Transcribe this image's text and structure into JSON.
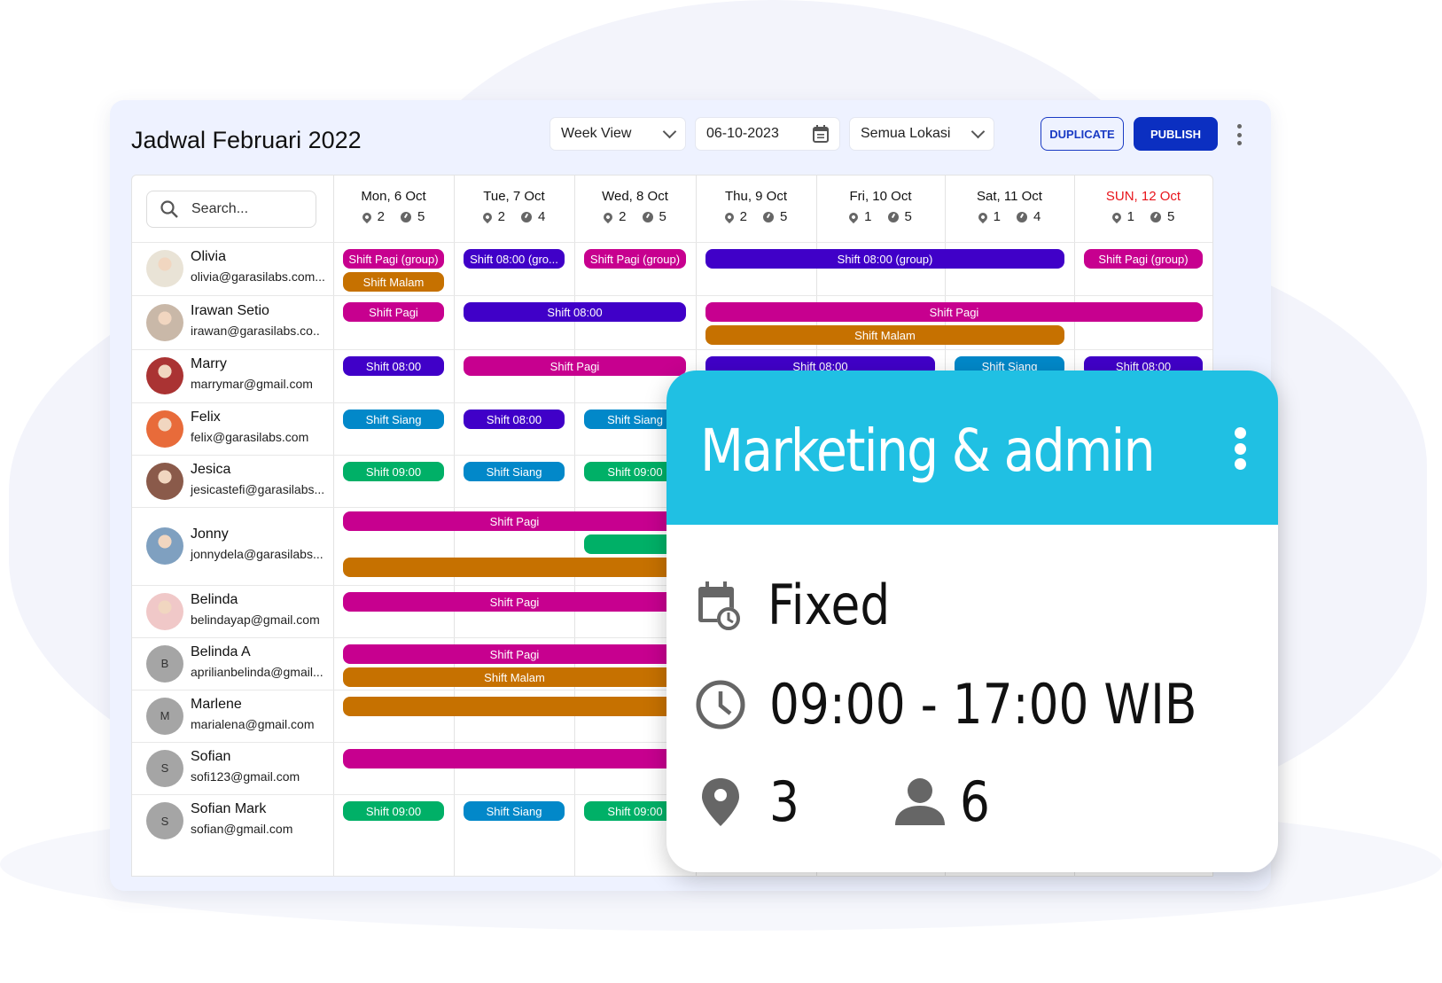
{
  "header": {
    "title": "Jadwal Februari 2022",
    "view_select": "Week View",
    "date_value": "06-10-2023",
    "location_select": "Semua Lokasi",
    "duplicate_label": "DUPLICATE",
    "publish_label": "PUBLISH"
  },
  "search": {
    "placeholder": "Search..."
  },
  "colors": {
    "accent": "#0b2fc1",
    "sunday": "#e8141b",
    "shift_pagi": "#c7008f",
    "shift_malam": "#c67100",
    "shift_0800": "#4000c8",
    "shift_siang": "#0288c9",
    "shift_0900": "#00b067",
    "popup_header": "#20c0e3"
  },
  "days": [
    {
      "label": "Mon, 6 Oct",
      "locations": "2",
      "shifts": "5"
    },
    {
      "label": "Tue, 7 Oct",
      "locations": "2",
      "shifts": "4"
    },
    {
      "label": "Wed, 8 Oct",
      "locations": "2",
      "shifts": "5"
    },
    {
      "label": "Thu, 9 Oct",
      "locations": "2",
      "shifts": "5"
    },
    {
      "label": "Fri, 10 Oct",
      "locations": "1",
      "shifts": "5"
    },
    {
      "label": "Sat, 11 Oct",
      "locations": "1",
      "shifts": "4"
    },
    {
      "label": "SUN, 12 Oct",
      "locations": "1",
      "shifts": "5"
    }
  ],
  "employees": [
    {
      "name": "Olivia",
      "email": "olivia@garasilabs.com...",
      "avatar": "photo"
    },
    {
      "name": "Irawan Setio",
      "email": "irawan@garasilabs.co..",
      "avatar": "photo"
    },
    {
      "name": "Marry",
      "email": "marrymar@gmail.com",
      "avatar": "photo"
    },
    {
      "name": "Felix",
      "email": "felix@garasilabs.com",
      "avatar": "photo"
    },
    {
      "name": "Jesica",
      "email": "jesicastefi@garasilabs...",
      "avatar": "photo"
    },
    {
      "name": "Jonny",
      "email": "jonnydela@garasilabs...",
      "avatar": "photo"
    },
    {
      "name": "Belinda",
      "email": "belindayap@gmail.com",
      "avatar": "photo"
    },
    {
      "name": "Belinda A",
      "email": "aprilianbelinda@gmail...",
      "avatar": "B"
    },
    {
      "name": "Marlene",
      "email": "marialena@gmail.com",
      "avatar": "M"
    },
    {
      "name": "Sofian",
      "email": "sofi123@gmail.com",
      "avatar": "S"
    },
    {
      "name": "Sofian Mark",
      "email": "sofian@gmail.com",
      "avatar": "S"
    }
  ],
  "shifts": [
    {
      "row": 0,
      "day": 0,
      "span": 1,
      "lane": 0,
      "label": "Shift Pagi (group)",
      "type": "pagi"
    },
    {
      "row": 0,
      "day": 0,
      "span": 1,
      "lane": 1,
      "label": "Shift Malam",
      "type": "malam"
    },
    {
      "row": 0,
      "day": 1,
      "span": 1,
      "lane": 0,
      "label": "Shift 08:00 (gro...",
      "type": "0800"
    },
    {
      "row": 0,
      "day": 2,
      "span": 1,
      "lane": 0,
      "label": "Shift Pagi (group)",
      "type": "pagi"
    },
    {
      "row": 0,
      "day": 3,
      "span": 3,
      "lane": 0,
      "label": "Shift 08:00 (group)",
      "type": "0800"
    },
    {
      "row": 0,
      "day": 6,
      "span": 1,
      "lane": 0,
      "label": "Shift Pagi (group)",
      "type": "pagi"
    },
    {
      "row": 1,
      "day": 0,
      "span": 1,
      "lane": 0,
      "label": "Shift Pagi",
      "type": "pagi"
    },
    {
      "row": 1,
      "day": 1,
      "span": 2,
      "lane": 0,
      "label": "Shift 08:00",
      "type": "0800"
    },
    {
      "row": 1,
      "day": 3,
      "span": 4,
      "lane": 0,
      "label": "Shift Pagi",
      "type": "pagi"
    },
    {
      "row": 1,
      "day": 3,
      "span": 3,
      "lane": 1,
      "label": "Shift Malam",
      "type": "malam"
    },
    {
      "row": 2,
      "day": 0,
      "span": 1,
      "lane": 0,
      "label": "Shift 08:00",
      "type": "0800"
    },
    {
      "row": 2,
      "day": 1,
      "span": 2,
      "lane": 0,
      "label": "Shift Pagi",
      "type": "pagi"
    },
    {
      "row": 2,
      "day": 3,
      "span": 2,
      "lane": 0,
      "label": "Shift 08:00",
      "type": "0800"
    },
    {
      "row": 2,
      "day": 5,
      "span": 1,
      "lane": 0,
      "label": "Shift Siang",
      "type": "siang"
    },
    {
      "row": 2,
      "day": 6,
      "span": 1,
      "lane": 0,
      "label": "Shift 08:00",
      "type": "0800"
    },
    {
      "row": 3,
      "day": 0,
      "span": 1,
      "lane": 0,
      "label": "Shift Siang",
      "type": "siang"
    },
    {
      "row": 3,
      "day": 1,
      "span": 1,
      "lane": 0,
      "label": "Shift 08:00",
      "type": "0800"
    },
    {
      "row": 3,
      "day": 2,
      "span": 1,
      "lane": 0,
      "label": "Shift Siang",
      "type": "siang"
    },
    {
      "row": 4,
      "day": 0,
      "span": 1,
      "lane": 0,
      "label": "Shift 09:00",
      "type": "0900"
    },
    {
      "row": 4,
      "day": 1,
      "span": 1,
      "lane": 0,
      "label": "Shift Siang",
      "type": "siang"
    },
    {
      "row": 4,
      "day": 2,
      "span": 1,
      "lane": 0,
      "label": "Shift 09:00",
      "type": "0900"
    },
    {
      "row": 5,
      "day": 0,
      "span": 3,
      "lane": 0,
      "label": "Shift Pagi",
      "type": "pagi"
    },
    {
      "row": 5,
      "day": 2,
      "span": 1,
      "lane": 1,
      "label": "",
      "type": "0900"
    },
    {
      "row": 5,
      "day": 0,
      "span": 3,
      "lane": 2,
      "label": "",
      "type": "malam"
    },
    {
      "row": 6,
      "day": 0,
      "span": 3,
      "lane": 0,
      "label": "Shift Pagi",
      "type": "pagi"
    },
    {
      "row": 7,
      "day": 0,
      "span": 3,
      "lane": 0,
      "label": "Shift Pagi",
      "type": "pagi"
    },
    {
      "row": 7,
      "day": 0,
      "span": 3,
      "lane": 1,
      "label": "Shift Malam",
      "type": "malam"
    },
    {
      "row": 8,
      "day": 0,
      "span": 3,
      "lane": 0,
      "label": "",
      "type": "malam"
    },
    {
      "row": 9,
      "day": 0,
      "span": 3,
      "lane": 0,
      "label": "",
      "type": "pagi"
    },
    {
      "row": 10,
      "day": 0,
      "span": 1,
      "lane": 0,
      "label": "Shift 09:00",
      "type": "0900"
    },
    {
      "row": 10,
      "day": 1,
      "span": 1,
      "lane": 0,
      "label": "Shift Siang",
      "type": "siang"
    },
    {
      "row": 10,
      "day": 2,
      "span": 1,
      "lane": 0,
      "label": "Shift 09:00",
      "type": "0900"
    }
  ],
  "popup": {
    "title": "Marketing & admin",
    "schedule_type": "Fixed",
    "time_range": "09:00 - 17:00 WIB",
    "locations": "3",
    "people": "6"
  }
}
